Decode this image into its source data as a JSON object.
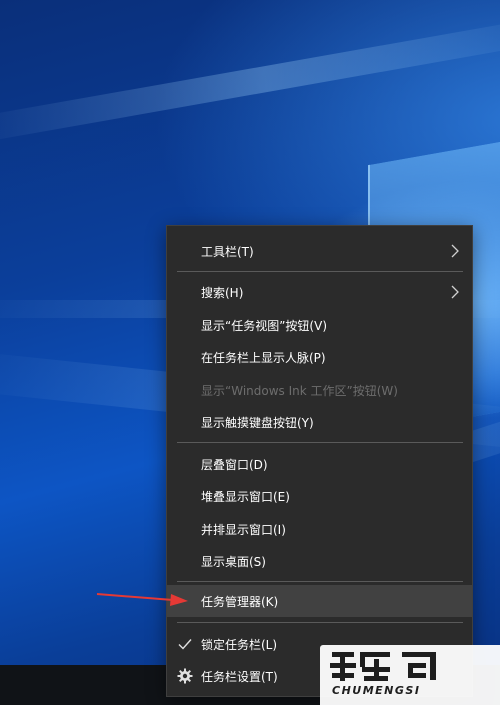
{
  "menu": {
    "items": [
      {
        "label": "工具栏(T)",
        "submenu": true
      },
      {
        "label": "搜索(H)",
        "submenu": true
      },
      {
        "label": "显示“任务视图”按钮(V)"
      },
      {
        "label": "在任务栏上显示人脉(P)"
      },
      {
        "label": "显示“Windows Ink 工作区”按钮(W)",
        "disabled": true
      },
      {
        "label": "显示触摸键盘按钮(Y)"
      },
      {
        "label": "层叠窗口(D)"
      },
      {
        "label": "堆叠显示窗口(E)"
      },
      {
        "label": "并排显示窗口(I)"
      },
      {
        "label": "显示桌面(S)"
      },
      {
        "label": "任务管理器(K)",
        "highlighted": true
      },
      {
        "label": "锁定任务栏(L)",
        "checked": true
      },
      {
        "label": "任务栏设置(T)",
        "icon": "gear-icon"
      }
    ]
  },
  "watermark": {
    "brand_text": "CHUMENGSI"
  },
  "colors": {
    "menu_bg": "#2b2b2b",
    "menu_hover": "#414141",
    "arrow": "#e53935"
  }
}
